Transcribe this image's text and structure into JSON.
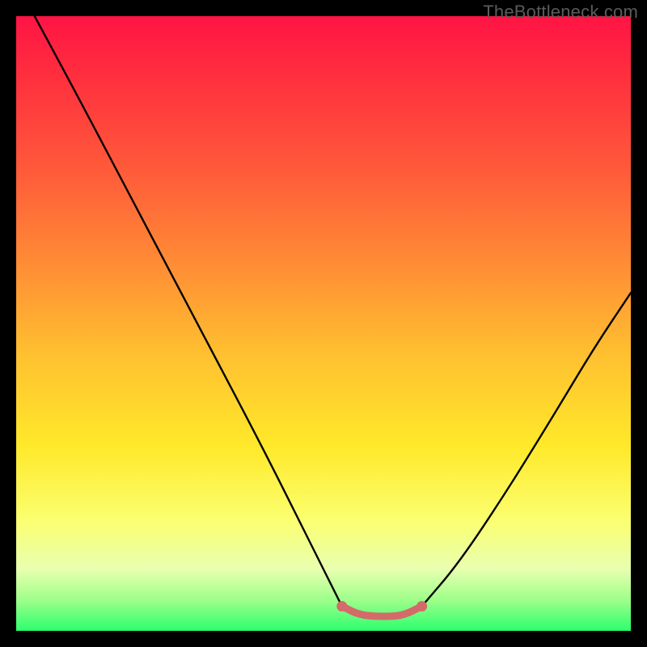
{
  "watermark": "TheBottleneck.com",
  "colors": {
    "gradient_top": "#ff1445",
    "gradient_mid1": "#ff8b35",
    "gradient_mid2": "#ffe92a",
    "gradient_bottom": "#2bff6e",
    "curve_stroke": "#000000",
    "flat_segment_stroke": "#d46a6a",
    "flat_segment_dot": "#d46a6a",
    "frame": "#000000"
  },
  "chart_data": {
    "type": "line",
    "title": "",
    "xlabel": "",
    "ylabel": "",
    "xlim": [
      0,
      100
    ],
    "ylim": [
      0,
      100
    ],
    "grid": false,
    "legend": false,
    "description": "V-shaped bottleneck curve over a red-to-green vertical gradient. Left branch descends steeply from top-left to a flat minimum around x≈55–65 at y≈3, then the right branch rises with gentle curvature toward the right edge reaching y≈55 at x=100. A short salmon-colored flat segment with round endpoints marks the optimum region at the valley bottom.",
    "series": [
      {
        "name": "left-branch",
        "x": [
          3,
          10,
          20,
          30,
          40,
          48,
          53
        ],
        "y": [
          100,
          87,
          68,
          49,
          30,
          14,
          4
        ]
      },
      {
        "name": "right-branch",
        "x": [
          66,
          72,
          80,
          88,
          94,
          100
        ],
        "y": [
          4,
          11,
          23,
          36,
          46,
          55
        ]
      },
      {
        "name": "optimum-flat",
        "x": [
          53,
          56,
          60,
          63,
          66
        ],
        "y": [
          4,
          2.5,
          2.3,
          2.5,
          4
        ]
      }
    ],
    "annotations": [
      {
        "type": "endpoint-dot",
        "series": "optimum-flat",
        "x": 53,
        "y": 4
      },
      {
        "type": "endpoint-dot",
        "series": "optimum-flat",
        "x": 66,
        "y": 4
      }
    ]
  }
}
